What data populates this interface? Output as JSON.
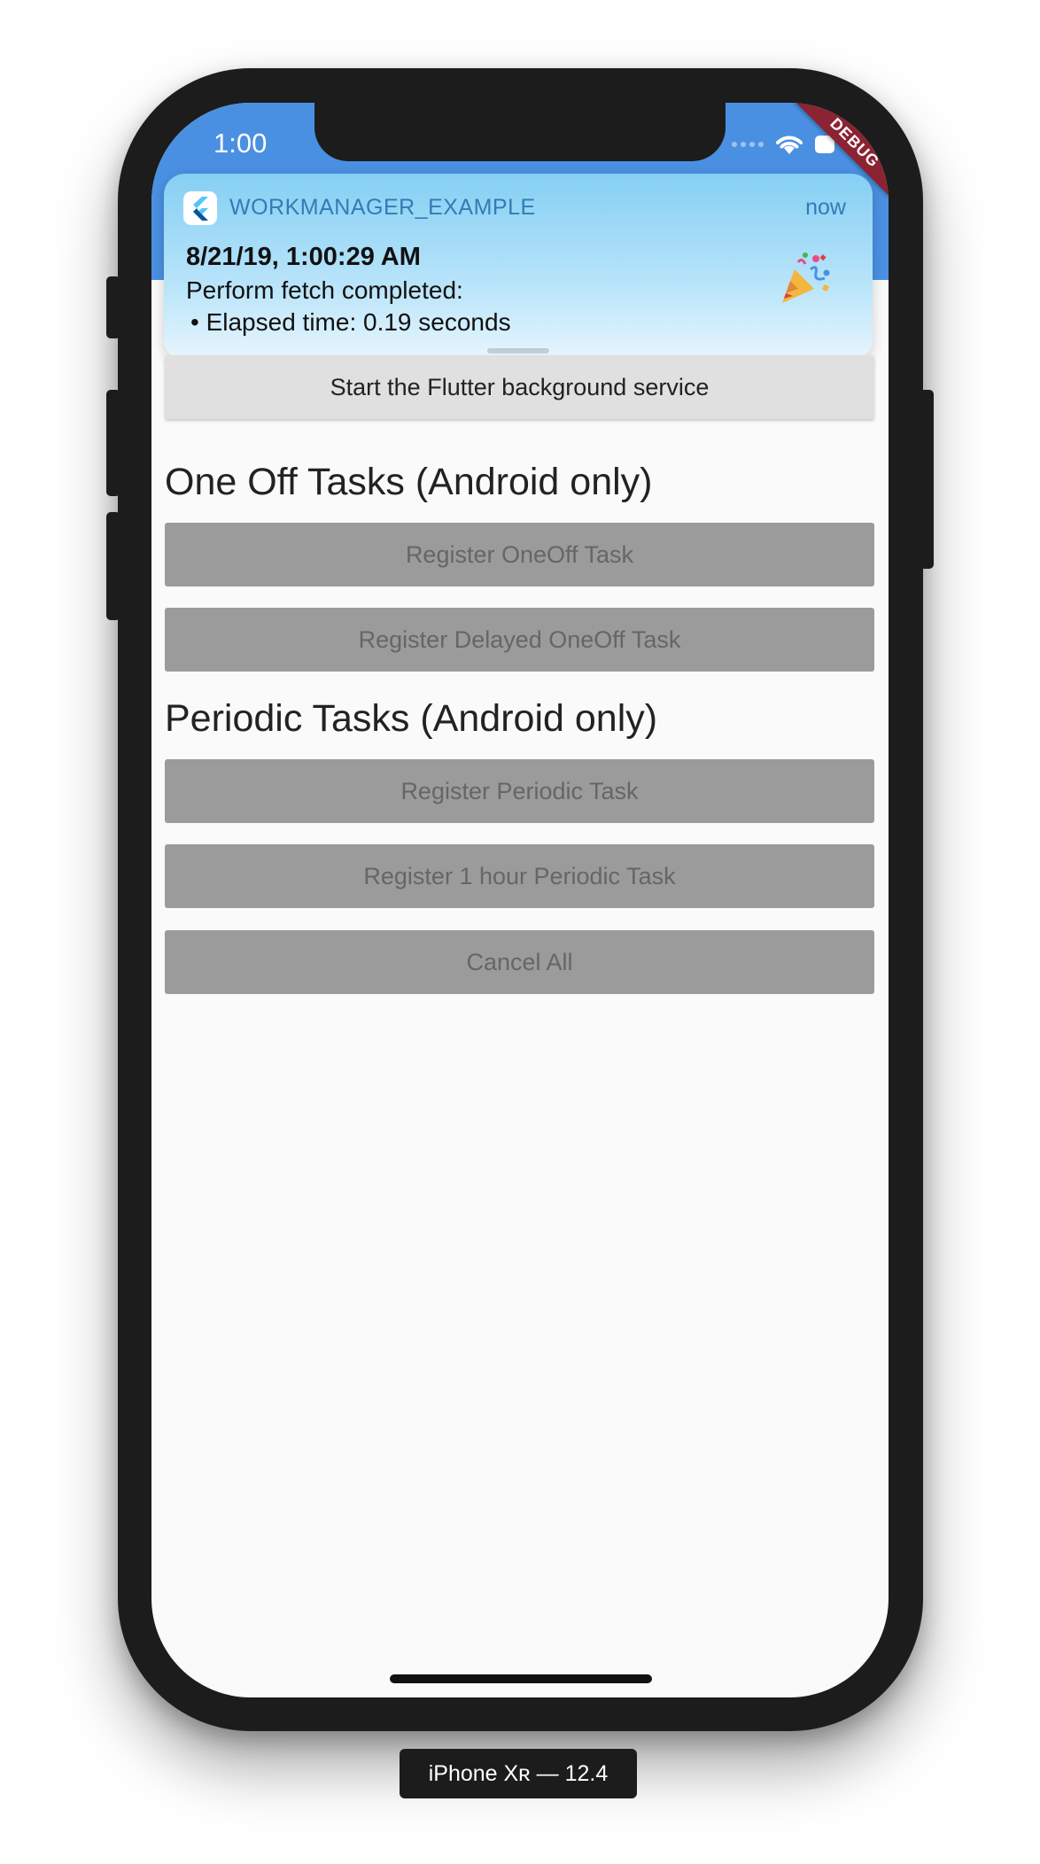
{
  "status_bar": {
    "time": "1:00"
  },
  "debug_banner": "DEBUG",
  "notification": {
    "app_name": "WORKMANAGER_EXAMPLE",
    "time": "now",
    "title": "8/21/19, 1:00:29 AM",
    "line1": "Perform fetch completed:",
    "line2": "• Elapsed time: 0.19 seconds",
    "app_icon": "flutter-logo-icon",
    "emoji_icon": "party-popper-icon"
  },
  "main": {
    "start_button": "Start the Flutter background service",
    "one_off_section": {
      "title": "One Off Tasks (Android only)",
      "buttons": [
        "Register OneOff Task",
        "Register Delayed OneOff Task"
      ]
    },
    "periodic_section": {
      "title": "Periodic Tasks (Android only)",
      "buttons": [
        "Register Periodic Task",
        "Register 1 hour Periodic Task",
        "Cancel All"
      ]
    }
  },
  "device_label": "iPhone Xʀ — 12.4",
  "colors": {
    "app_bar": "#4a90e2",
    "debug_banner": "#8b2332",
    "disabled_button": "#9b9b9b"
  }
}
